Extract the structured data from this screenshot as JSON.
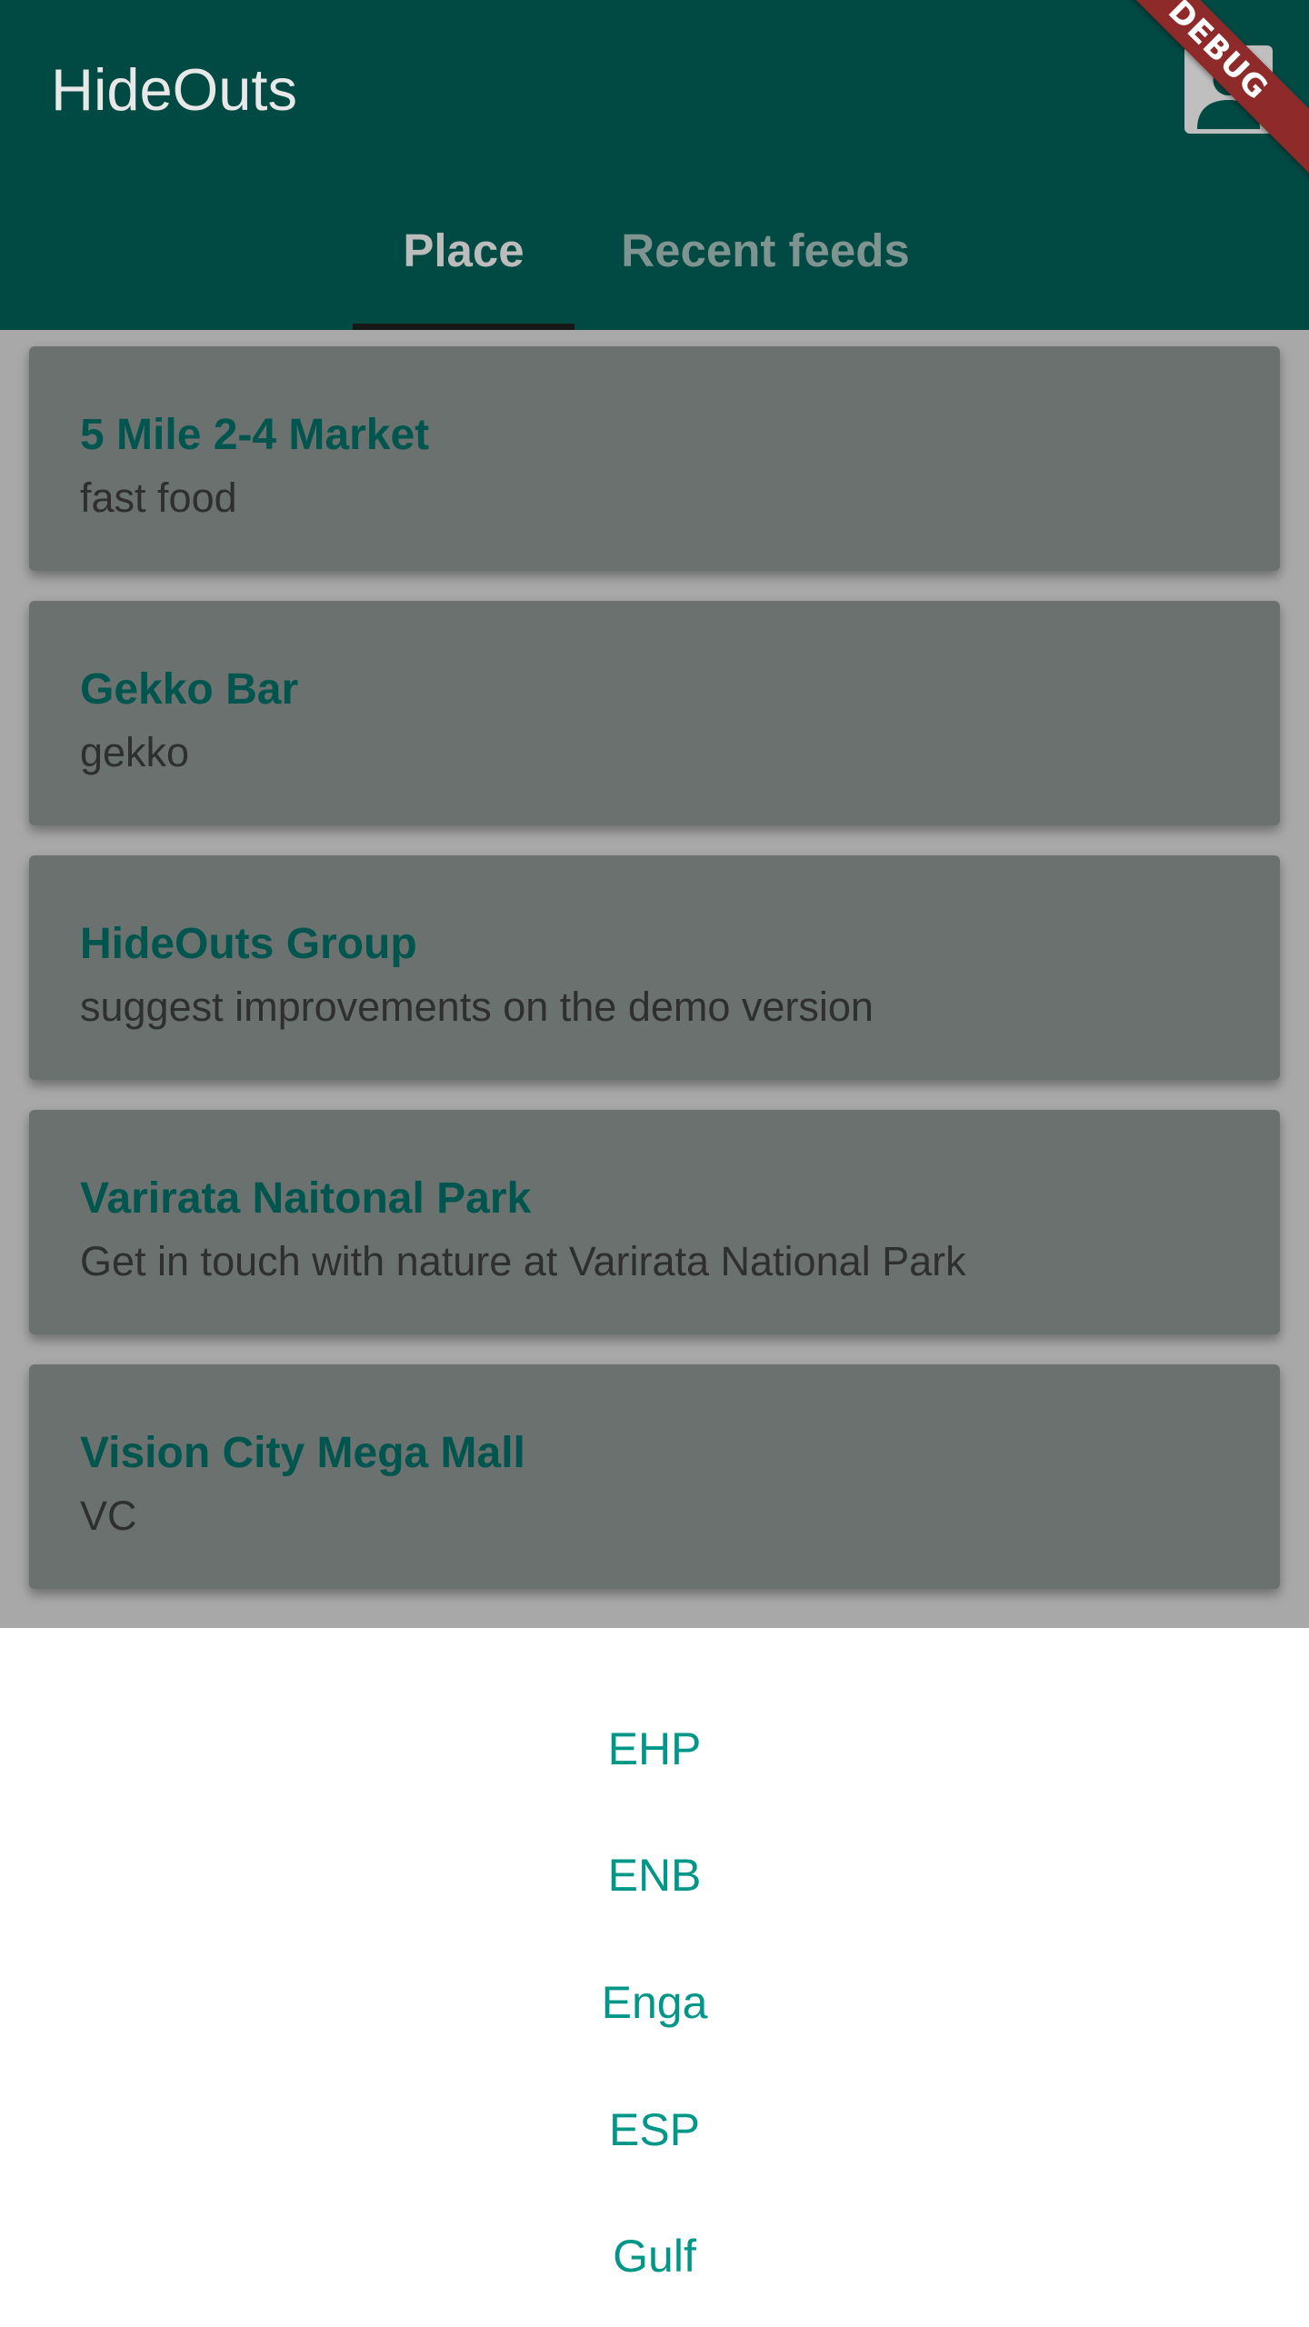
{
  "appbar": {
    "title": "HideOuts",
    "account_icon": "account-icon",
    "debug_label": "DEBUG",
    "colors": {
      "background": "#004a43",
      "indicator": "#171717"
    }
  },
  "tabs": [
    {
      "label": "Place",
      "selected": true
    },
    {
      "label": "Recent feeds",
      "selected": false
    }
  ],
  "places": [
    {
      "name": "5 Mile 2-4 Market",
      "description": "fast food"
    },
    {
      "name": "Gekko Bar",
      "description": "gekko"
    },
    {
      "name": "HideOuts Group",
      "description": "suggest improvements on the demo version"
    },
    {
      "name": "Varirata Naitonal Park",
      "description": "Get in touch with nature at Varirata National Park"
    },
    {
      "name": "Vision City Mega Mall",
      "description": "VC"
    }
  ],
  "bottom_sheet": {
    "options": [
      "EHP",
      "ENB",
      "Enga",
      "ESP",
      "Gulf"
    ],
    "option_color": "#009688"
  }
}
